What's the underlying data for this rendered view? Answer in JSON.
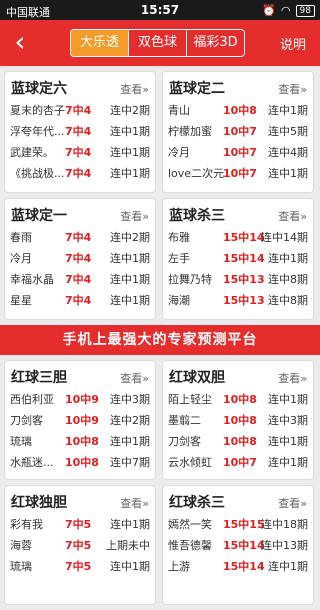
{
  "status": {
    "carrier": "中国联通",
    "time": "15:57",
    "battery": "98"
  },
  "nav": {
    "back_icon": "chevron-left",
    "tabs": [
      "大乐透",
      "双色球",
      "福彩3D"
    ],
    "active_tab": 0,
    "explain": "说明"
  },
  "cards_top": [
    {
      "title": "蓝球定六",
      "more": "查看»",
      "rows": [
        {
          "name": "夏末的杏子",
          "pick": "7中4",
          "streak": "连中2期"
        },
        {
          "name": "浮夸年代...",
          "pick": "7中4",
          "streak": "连中1期"
        },
        {
          "name": "武建荣。",
          "pick": "7中4",
          "streak": "连中1期"
        },
        {
          "name": "《挑战极...",
          "pick": "7中4",
          "streak": "连中1期"
        }
      ]
    },
    {
      "title": "蓝球定二",
      "more": "查看»",
      "rows": [
        {
          "name": "青山",
          "pick": "10中8",
          "streak": "连中1期"
        },
        {
          "name": "柠檬加蜜",
          "pick": "10中7",
          "streak": "连中5期"
        },
        {
          "name": "冷月",
          "pick": "10中7",
          "streak": "连中4期"
        },
        {
          "name": "love二次元",
          "pick": "10中7",
          "streak": "连中1期"
        }
      ]
    },
    {
      "title": "蓝球定一",
      "more": "查看»",
      "rows": [
        {
          "name": "春雨",
          "pick": "7中4",
          "streak": "连中2期"
        },
        {
          "name": "冷月",
          "pick": "7中4",
          "streak": "连中1期"
        },
        {
          "name": "幸福水晶",
          "pick": "7中4",
          "streak": "连中1期"
        },
        {
          "name": "星星",
          "pick": "7中4",
          "streak": "连中1期"
        }
      ]
    },
    {
      "title": "蓝球杀三",
      "more": "查看»",
      "rows": [
        {
          "name": "布雅",
          "pick": "15中14",
          "streak": "连中14期"
        },
        {
          "name": "左手",
          "pick": "15中14",
          "streak": "连中1期"
        },
        {
          "name": "拉舞乃特",
          "pick": "15中13",
          "streak": "连中8期"
        },
        {
          "name": "海潮",
          "pick": "15中13",
          "streak": "连中8期"
        }
      ]
    }
  ],
  "banner": "手机上最强大的专家预测平台",
  "cards_bottom": [
    {
      "title": "红球三胆",
      "more": "查看»",
      "rows": [
        {
          "name": "西伯利亚",
          "pick": "10中9",
          "streak": "连中3期"
        },
        {
          "name": "刀剑客",
          "pick": "10中9",
          "streak": "连中2期"
        },
        {
          "name": "琉璃",
          "pick": "10中8",
          "streak": "连中1期"
        },
        {
          "name": "水瓶迷...",
          "pick": "10中8",
          "streak": "连中7期"
        }
      ]
    },
    {
      "title": "红球双胆",
      "more": "查看»",
      "rows": [
        {
          "name": "陌上轻尘",
          "pick": "10中8",
          "streak": "连中1期"
        },
        {
          "name": "墨翦二",
          "pick": "10中8",
          "streak": "连中3期"
        },
        {
          "name": "刀剑客",
          "pick": "10中8",
          "streak": "连中1期"
        },
        {
          "name": "云水倾虹",
          "pick": "10中7",
          "streak": "连中1期"
        }
      ]
    },
    {
      "title": "红球独胆",
      "more": "查看»",
      "rows": [
        {
          "name": "彩有我",
          "pick": "7中5",
          "streak": "连中1期"
        },
        {
          "name": "海蓉",
          "pick": "7中5",
          "streak": "上期未中"
        },
        {
          "name": "琉璃",
          "pick": "7中5",
          "streak": "连中1期"
        }
      ]
    },
    {
      "title": "红球杀三",
      "more": "查看»",
      "rows": [
        {
          "name": "嫣然一笑",
          "pick": "15中15",
          "streak": "连中18期"
        },
        {
          "name": "惟吾德馨",
          "pick": "15中14",
          "streak": "连中13期"
        },
        {
          "name": "上游",
          "pick": "15中14",
          "streak": "连中1期"
        }
      ]
    }
  ]
}
